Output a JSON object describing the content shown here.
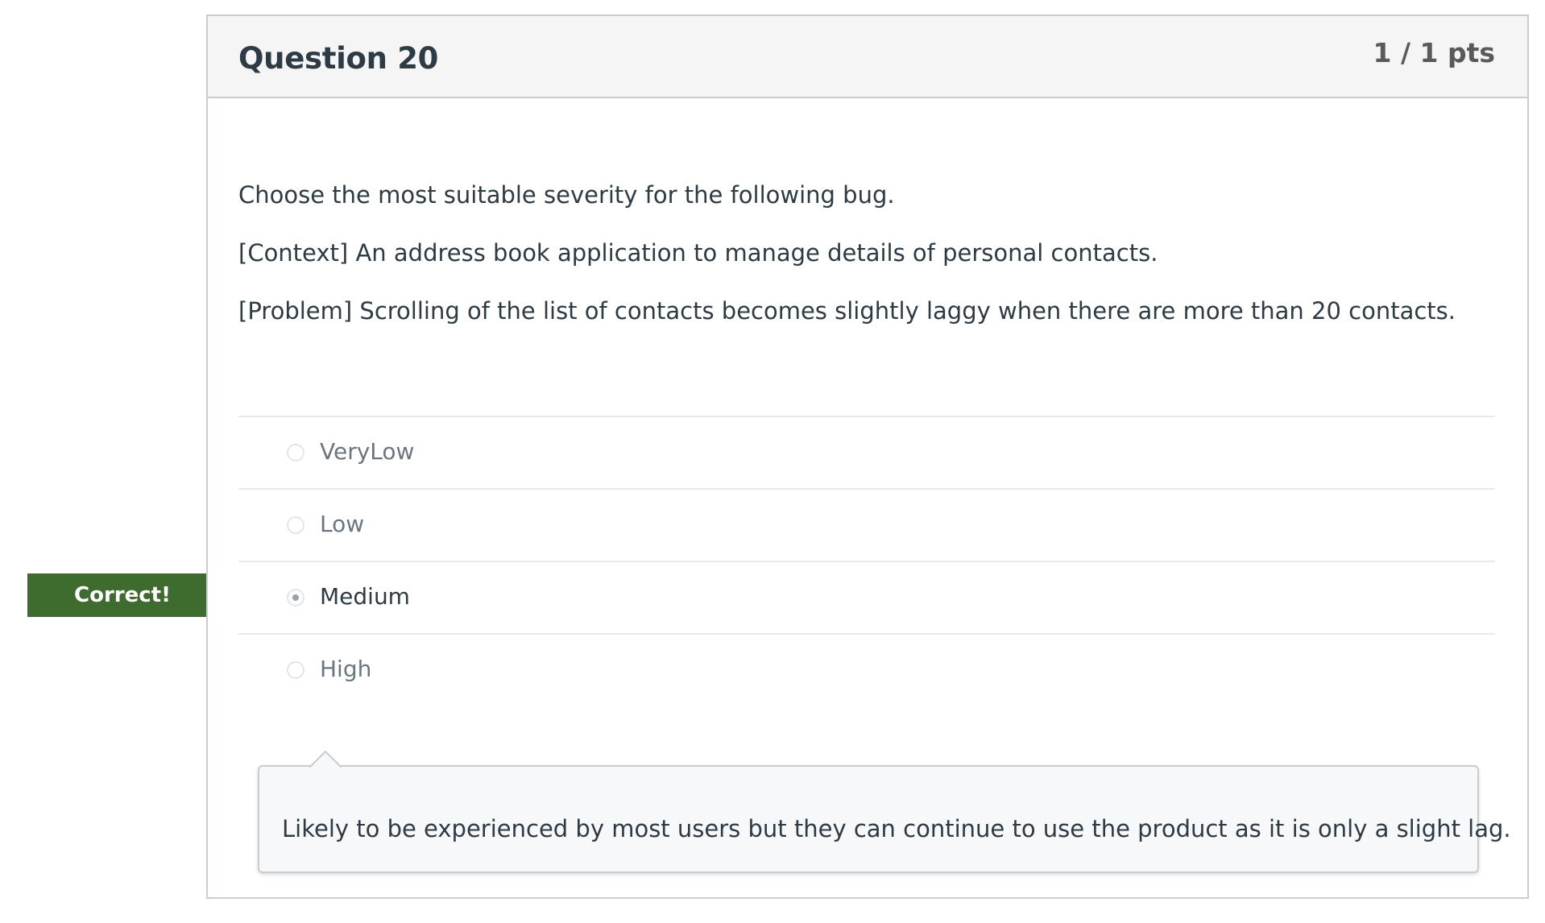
{
  "question": {
    "title": "Question 20",
    "points": "1 / 1 pts",
    "paragraphs": [
      "Choose the most suitable severity for the following bug.",
      "[Context] An address book application to manage details of personal contacts.",
      "[Problem] Scrolling of the list of contacts becomes slightly laggy when there are more than 20 contacts."
    ]
  },
  "result": {
    "label": "Correct!",
    "color": "#3e6b2e"
  },
  "answers": [
    {
      "label": "VeryLow",
      "selected": false
    },
    {
      "label": "Low",
      "selected": false
    },
    {
      "label": "Medium",
      "selected": true
    },
    {
      "label": "High",
      "selected": false
    }
  ],
  "feedback": {
    "text": "Likely to be experienced by most users but they can continue to use the product as it is only a slight lag."
  }
}
